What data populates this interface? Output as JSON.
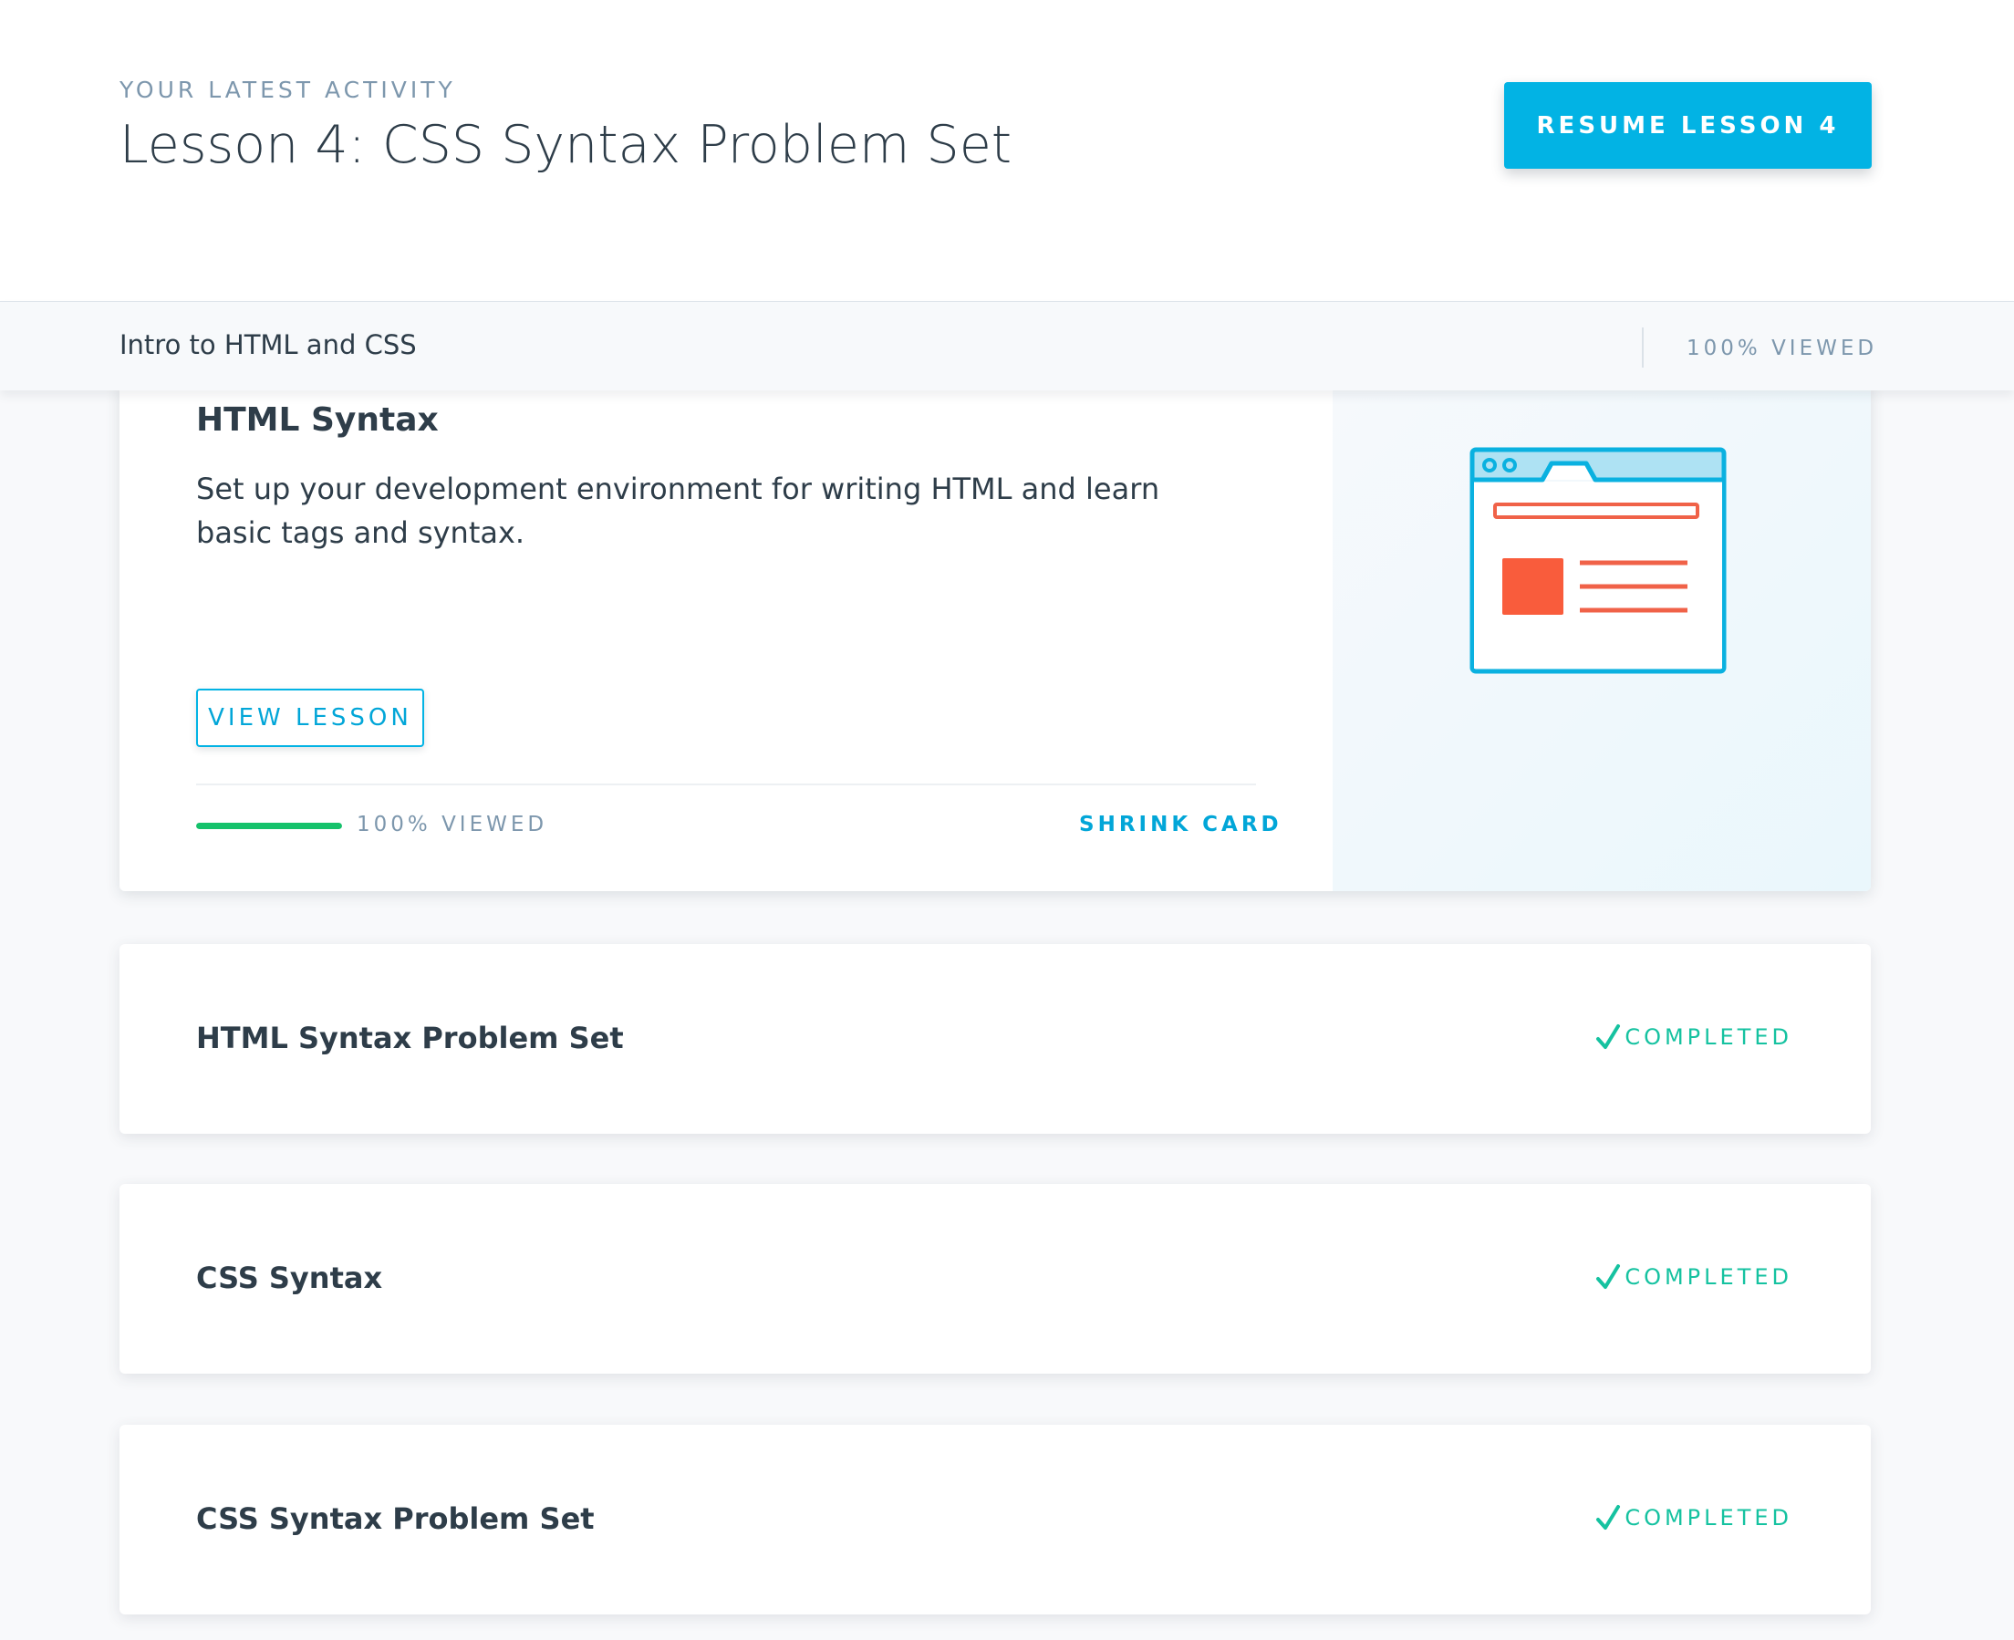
{
  "header": {
    "eyebrow": "YOUR LATEST ACTIVITY",
    "title": "Lesson 4: CSS Syntax Problem Set",
    "resume_label": "RESUME LESSON 4"
  },
  "course": {
    "name": "Intro to HTML and CSS",
    "progress_label": "100% VIEWED"
  },
  "expanded_lesson": {
    "title": "HTML Syntax",
    "description": "Set up your development environment for writing HTML and learn basic tags and syntax.",
    "view_label": "VIEW LESSON",
    "progress_label": "100% VIEWED",
    "progress_fraction": 1.0,
    "shrink_label": "SHRINK CARD",
    "illustration_icon": "browser-window-icon"
  },
  "lessons": [
    {
      "title": "HTML Syntax Problem Set",
      "status": "COMPLETED",
      "status_icon": "checkmark-icon"
    },
    {
      "title": "CSS Syntax",
      "status": "COMPLETED",
      "status_icon": "checkmark-icon"
    },
    {
      "title": "CSS Syntax Problem Set",
      "status": "COMPLETED",
      "status_icon": "checkmark-icon"
    }
  ],
  "colors": {
    "accent": "#02b3e4",
    "text": "#2e3d49",
    "muted": "#7d97ad",
    "progress": "#15c26b",
    "completed": "#15c2a0",
    "illustration_red": "#f95c3c"
  }
}
